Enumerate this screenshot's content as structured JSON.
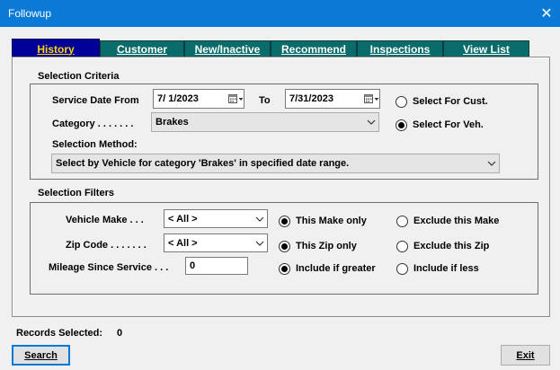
{
  "window": {
    "title": "Followup",
    "close_glyph": "✕"
  },
  "tabs": [
    {
      "label": "History",
      "active": true
    },
    {
      "label": "Customer"
    },
    {
      "label": "New/Inactive"
    },
    {
      "label": "Recommend"
    },
    {
      "label": "Inspections"
    },
    {
      "label": "View List"
    }
  ],
  "criteria": {
    "header": "Selection Criteria",
    "service_date_label": "Service Date From",
    "date_from": "7/ 1/2023",
    "to_label": "To",
    "date_to": "7/31/2023",
    "category_label": "Category . . . . . . .",
    "category_value": "Brakes",
    "method_label": "Selection Method:",
    "method_value": "Select by Vehicle for category 'Brakes' in specified date range.",
    "radio_cust": "Select For Cust.",
    "radio_veh": "Select For Veh.",
    "selected": "veh"
  },
  "filters": {
    "header": "Selection Filters",
    "make_label": "Vehicle Make . . .",
    "make_value": "< All >",
    "make_only": "This Make only",
    "make_exclude": "Exclude this Make",
    "zip_label": "Zip Code . . . . . . .",
    "zip_value": "< All >",
    "zip_only": "This Zip only",
    "zip_exclude": "Exclude this Zip",
    "mileage_label": "Mileage Since Service . . .",
    "mileage_value": "0",
    "include_greater": "Include if greater",
    "include_less": "Include if less"
  },
  "status": {
    "records_label": "Records Selected:",
    "records_value": "0"
  },
  "buttons": {
    "search": "Search",
    "exit": "Exit"
  },
  "colors": {
    "titlebar": "#0a7ad6",
    "tab_inactive": "#0a6b6b",
    "tab_active": "#000099",
    "tab_active_text": "#ffd700"
  }
}
